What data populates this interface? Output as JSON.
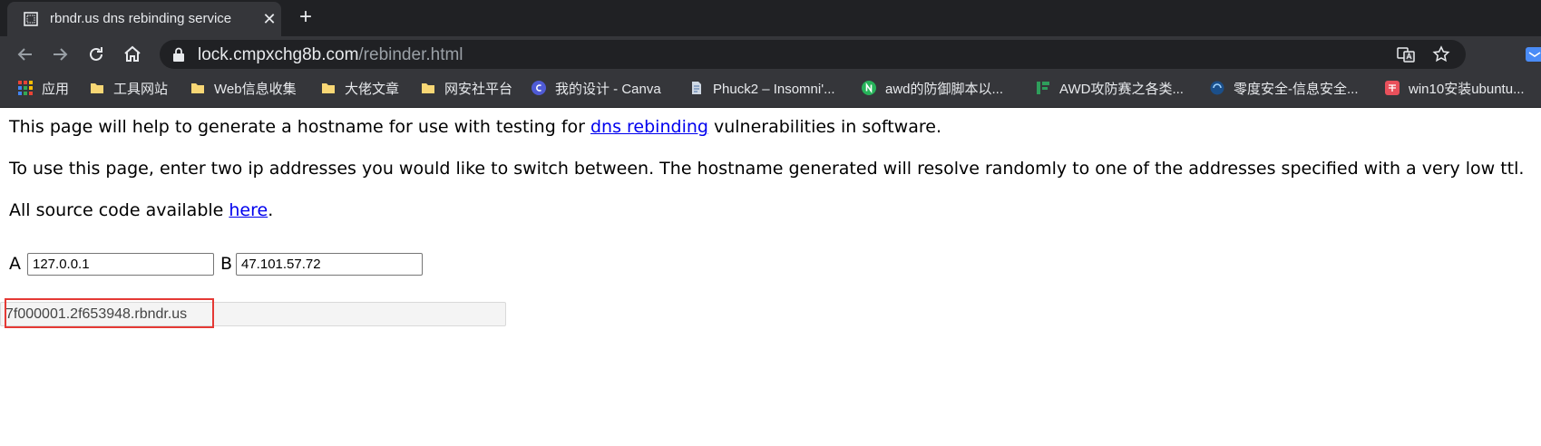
{
  "browser": {
    "tab": {
      "title": "rbndr.us dns rebinding service",
      "close": "✕"
    },
    "new_tab": "+",
    "address": {
      "host": "lock.cmpxchg8b.com",
      "path": "/rebinder.html"
    }
  },
  "bookmarks": [
    {
      "icon": "apps-grid-icon",
      "label": "应用"
    },
    {
      "icon": "folder-icon",
      "label": "工具网站"
    },
    {
      "icon": "folder-icon",
      "label": "Web信息收集"
    },
    {
      "icon": "folder-icon",
      "label": "大佬文章"
    },
    {
      "icon": "folder-icon",
      "label": "网安社平台"
    },
    {
      "icon": "canva-icon",
      "label": "我的设计 - Canva"
    },
    {
      "icon": "page-icon",
      "label": "Phuck2 – Insomni'..."
    },
    {
      "icon": "n-circle-icon",
      "label": "awd的防御脚本以..."
    },
    {
      "icon": "green-bars-icon",
      "label": "AWD攻防赛之各类..."
    },
    {
      "icon": "shield-logo-icon",
      "label": "零度安全-信息安全..."
    },
    {
      "icon": "jian-icon",
      "label": "win10安装ubuntu..."
    }
  ],
  "page": {
    "intro_before": "This page will help to generate a hostname for use with testing for ",
    "intro_link": "dns rebinding",
    "intro_after": " vulnerabilities in software.",
    "usage": "To use this page, enter two ip addresses you would like to switch between. The hostname generated will resolve randomly to one of the addresses specified with a very low ttl.",
    "source_before": "All source code available ",
    "source_link": "here",
    "source_after": ".",
    "label_a": "A",
    "value_a": "127.0.0.1",
    "label_b": "B",
    "value_b": "47.101.57.72",
    "result": "7f000001.2f653948.rbndr.us"
  },
  "colors": {
    "tab_strip": "#202124",
    "toolbar": "#35363a",
    "link": "#0000ee",
    "highlight": "#e53935"
  }
}
